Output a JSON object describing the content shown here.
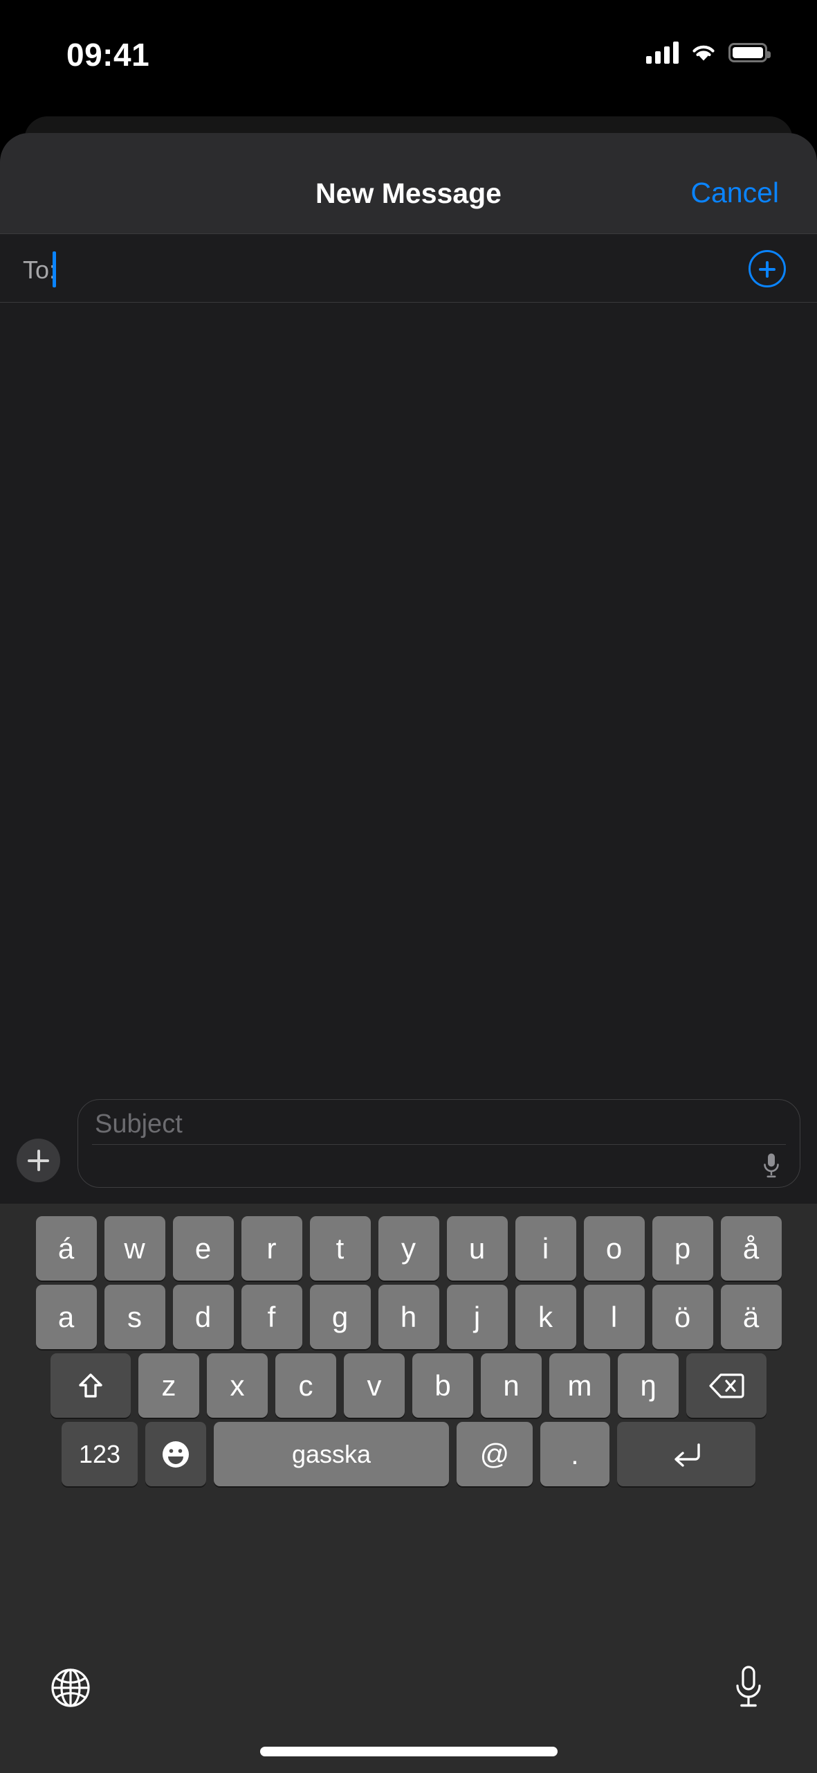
{
  "status_bar": {
    "time": "09:41",
    "cellular_icon": "cellular-signal-icon",
    "wifi_icon": "wifi-icon",
    "battery_icon": "battery-icon"
  },
  "nav": {
    "title": "New Message",
    "cancel_label": "Cancel"
  },
  "recipient": {
    "label": "To:",
    "value": "",
    "placeholder": "",
    "add_contact_icon": "add-contact-plus-icon"
  },
  "compose": {
    "attach_icon": "plus-icon",
    "subject_placeholder": "Subject",
    "body_value": "",
    "dictation_icon": "microphone-icon"
  },
  "keyboard": {
    "language": "Northern Sami",
    "row1": [
      "á",
      "w",
      "e",
      "r",
      "t",
      "y",
      "u",
      "i",
      "o",
      "p",
      "å"
    ],
    "row2": [
      "a",
      "s",
      "d",
      "f",
      "g",
      "h",
      "j",
      "k",
      "l",
      "ö",
      "ä"
    ],
    "row3_shift_icon": "shift-up-arrow-icon",
    "row3": [
      "z",
      "x",
      "c",
      "v",
      "b",
      "n",
      "m",
      "ŋ"
    ],
    "row3_delete_icon": "delete-backspace-icon",
    "numbers_label": "123",
    "emoji_icon": "emoji-smiley-icon",
    "space_label": "gasska",
    "at_label": "@",
    "dot_label": ".",
    "return_icon": "return-key-icon",
    "globe_icon": "globe-language-icon",
    "dictation_icon": "microphone-icon"
  },
  "home_indicator": "home-indicator-bar",
  "colors": {
    "accent_blue": "#0A84FF",
    "sheet_background": "#1C1C1E",
    "navbar_background": "#2C2C2E",
    "keyboard_background": "#2C2C2C",
    "key_background": "#7A7A7A",
    "key_dark_background": "#4A4A4A",
    "placeholder_text": "#6C6C70"
  }
}
